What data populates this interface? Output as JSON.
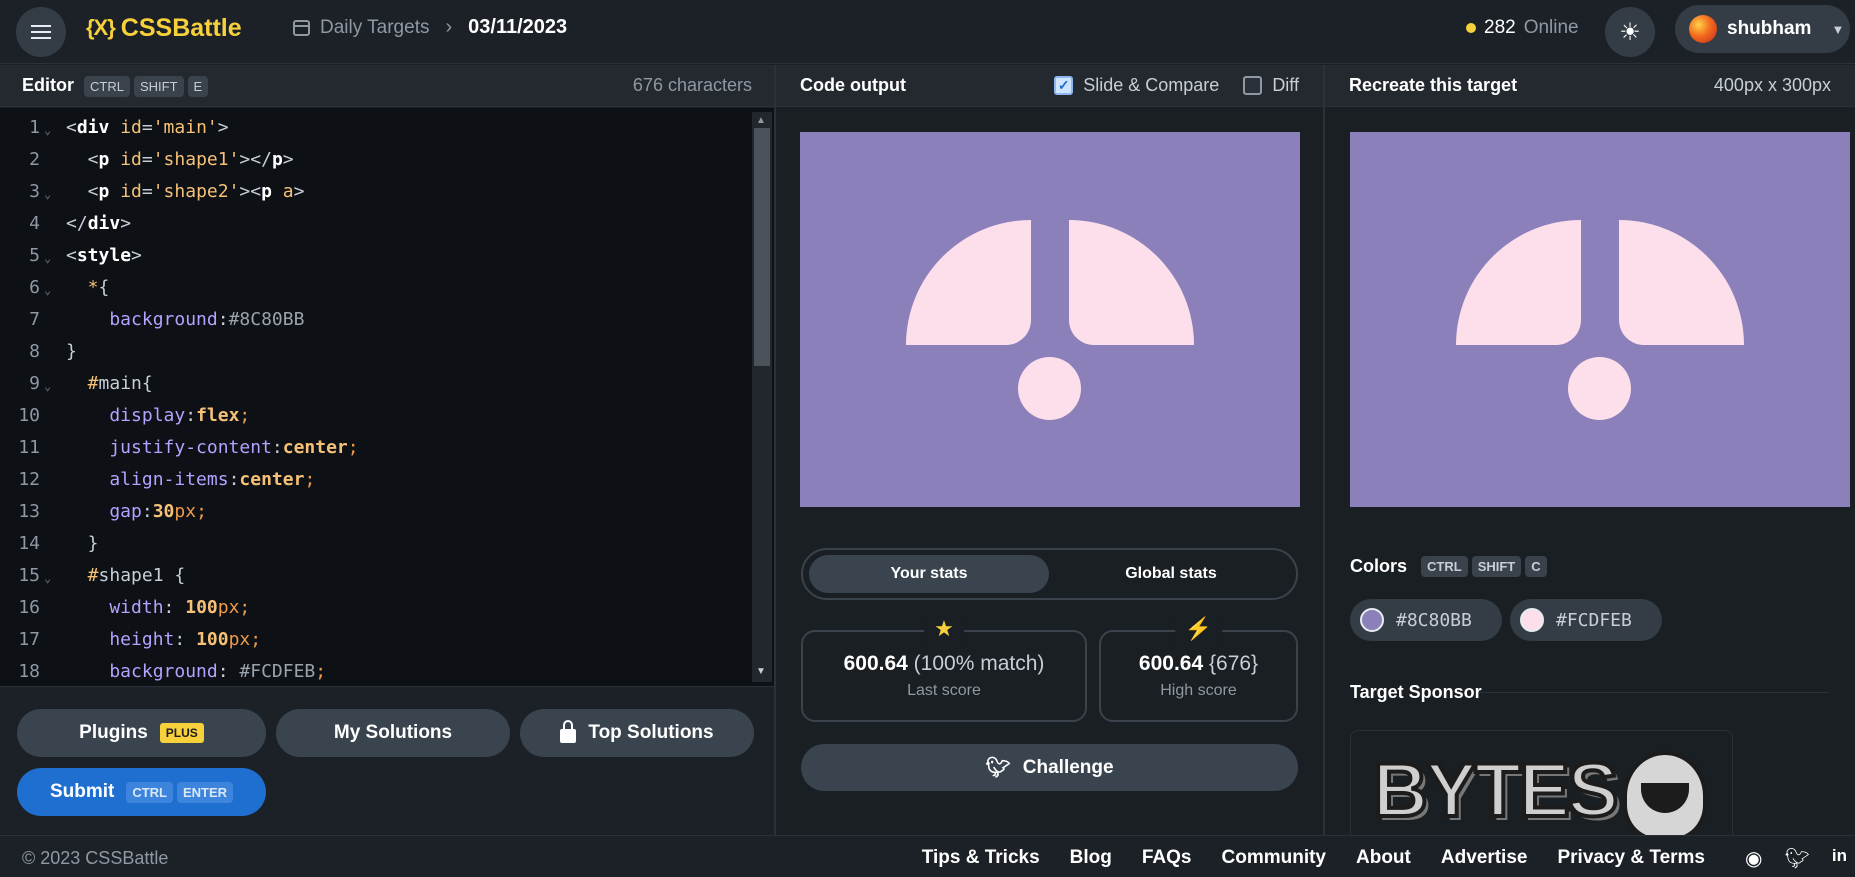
{
  "header": {
    "logo": "CSSBattle",
    "logo_mark": "{X}",
    "breadcrumb": [
      "Daily Targets",
      "03/11/2023"
    ],
    "online_count": "282",
    "online_label": "Online",
    "username": "shubham"
  },
  "editor": {
    "title": "Editor",
    "shortcut": [
      "CTRL",
      "SHIFT",
      "E"
    ],
    "char_count": "676 characters",
    "lines": [
      {
        "n": "1",
        "fold": true,
        "tokens": [
          [
            "p",
            "<"
          ],
          [
            "tag",
            "div"
          ],
          [
            "attr",
            " id"
          ],
          [
            "p",
            "="
          ],
          [
            "str",
            "'main'"
          ],
          [
            "p",
            ">"
          ]
        ]
      },
      {
        "n": "2",
        "fold": false,
        "tokens": [
          [
            "p",
            "  <"
          ],
          [
            "tag",
            "p"
          ],
          [
            "attr",
            " id"
          ],
          [
            "p",
            "="
          ],
          [
            "str",
            "'shape1'"
          ],
          [
            "p",
            "></"
          ],
          [
            "tag",
            "p"
          ],
          [
            "p",
            ">"
          ]
        ]
      },
      {
        "n": "3",
        "fold": true,
        "tokens": [
          [
            "p",
            "  <"
          ],
          [
            "tag",
            "p"
          ],
          [
            "attr",
            " id"
          ],
          [
            "p",
            "="
          ],
          [
            "str",
            "'shape2'"
          ],
          [
            "p",
            "><"
          ],
          [
            "tag",
            "p"
          ],
          [
            "attr",
            " a"
          ],
          [
            "p",
            ">"
          ]
        ]
      },
      {
        "n": "4",
        "fold": false,
        "tokens": [
          [
            "p",
            "</"
          ],
          [
            "tag",
            "div"
          ],
          [
            "p",
            ">"
          ]
        ]
      },
      {
        "n": "5",
        "fold": true,
        "tokens": [
          [
            "p",
            "<"
          ],
          [
            "tag",
            "style"
          ],
          [
            "p",
            ">"
          ]
        ]
      },
      {
        "n": "6",
        "fold": true,
        "tokens": [
          [
            "sel",
            "  *"
          ],
          [
            "p",
            "{"
          ]
        ]
      },
      {
        "n": "7",
        "fold": false,
        "tokens": [
          [
            "prop",
            "    background"
          ],
          [
            "p",
            ":"
          ],
          [
            "hex",
            "#8C80BB"
          ]
        ]
      },
      {
        "n": "8",
        "fold": false,
        "tokens": [
          [
            "p",
            "}"
          ]
        ]
      },
      {
        "n": "9",
        "fold": true,
        "tokens": [
          [
            "sel",
            "  #"
          ],
          [
            "p",
            "main{"
          ]
        ]
      },
      {
        "n": "10",
        "fold": false,
        "tokens": [
          [
            "prop",
            "    display"
          ],
          [
            "p",
            ":"
          ],
          [
            "val",
            "flex"
          ],
          [
            "unit",
            ";"
          ]
        ]
      },
      {
        "n": "11",
        "fold": false,
        "tokens": [
          [
            "prop",
            "    justify-content"
          ],
          [
            "p",
            ":"
          ],
          [
            "val",
            "center"
          ],
          [
            "unit",
            ";"
          ]
        ]
      },
      {
        "n": "12",
        "fold": false,
        "tokens": [
          [
            "prop",
            "    align-items"
          ],
          [
            "p",
            ":"
          ],
          [
            "val",
            "center"
          ],
          [
            "unit",
            ";"
          ]
        ]
      },
      {
        "n": "13",
        "fold": false,
        "tokens": [
          [
            "prop",
            "    gap"
          ],
          [
            "p",
            ":"
          ],
          [
            "val",
            "30"
          ],
          [
            "unit",
            "px;"
          ]
        ]
      },
      {
        "n": "14",
        "fold": false,
        "tokens": [
          [
            "p",
            "  }"
          ]
        ]
      },
      {
        "n": "15",
        "fold": true,
        "tokens": [
          [
            "sel",
            "  #"
          ],
          [
            "p",
            "shape1 {"
          ]
        ]
      },
      {
        "n": "16",
        "fold": false,
        "tokens": [
          [
            "prop",
            "    width"
          ],
          [
            "p",
            ": "
          ],
          [
            "val",
            "100"
          ],
          [
            "unit",
            "px;"
          ]
        ]
      },
      {
        "n": "17",
        "fold": false,
        "tokens": [
          [
            "prop",
            "    height"
          ],
          [
            "p",
            ": "
          ],
          [
            "val",
            "100"
          ],
          [
            "unit",
            "px;"
          ]
        ]
      },
      {
        "n": "18",
        "fold": false,
        "tokens": [
          [
            "prop",
            "    background"
          ],
          [
            "p",
            ": "
          ],
          [
            "hex",
            "#FCDFEB"
          ],
          [
            "unit",
            ";"
          ]
        ]
      }
    ],
    "buttons": {
      "plugins": "Plugins",
      "plus_badge": "PLUS",
      "my_solutions": "My Solutions",
      "top_solutions": "Top Solutions",
      "submit": "Submit",
      "submit_keys": [
        "CTRL",
        "ENTER"
      ]
    }
  },
  "output": {
    "title": "Code output",
    "slide_compare": "Slide & Compare",
    "slide_compare_checked": true,
    "diff": "Diff",
    "diff_checked": false,
    "tabs": [
      "Your stats",
      "Global stats"
    ],
    "active_tab": "Your stats",
    "last_score": "600.64",
    "last_match": "(100% match)",
    "last_label": "Last score",
    "high_score": "600.64",
    "high_chars": "{676}",
    "high_label": "High score",
    "challenge": "Challenge"
  },
  "target": {
    "title": "Recreate this target",
    "size": "400px x 300px",
    "colors_label": "Colors",
    "colors_shortcut": [
      "CTRL",
      "SHIFT",
      "C"
    ],
    "colors": [
      "#8C80BB",
      "#FCDFEB"
    ],
    "sponsor_label": "Target Sponsor",
    "sponsor_name": "BYTES"
  },
  "footer": {
    "copyright": "© 2023 CSSBattle",
    "links": [
      "Tips & Tricks",
      "Blog",
      "FAQs",
      "Community",
      "About",
      "Advertise",
      "Privacy & Terms"
    ]
  },
  "theme": {
    "canvas_bg": "#8c80bb",
    "shape_color": "#fcdfeb",
    "brand": "#f7d13b",
    "submit": "#1f6fd1"
  }
}
